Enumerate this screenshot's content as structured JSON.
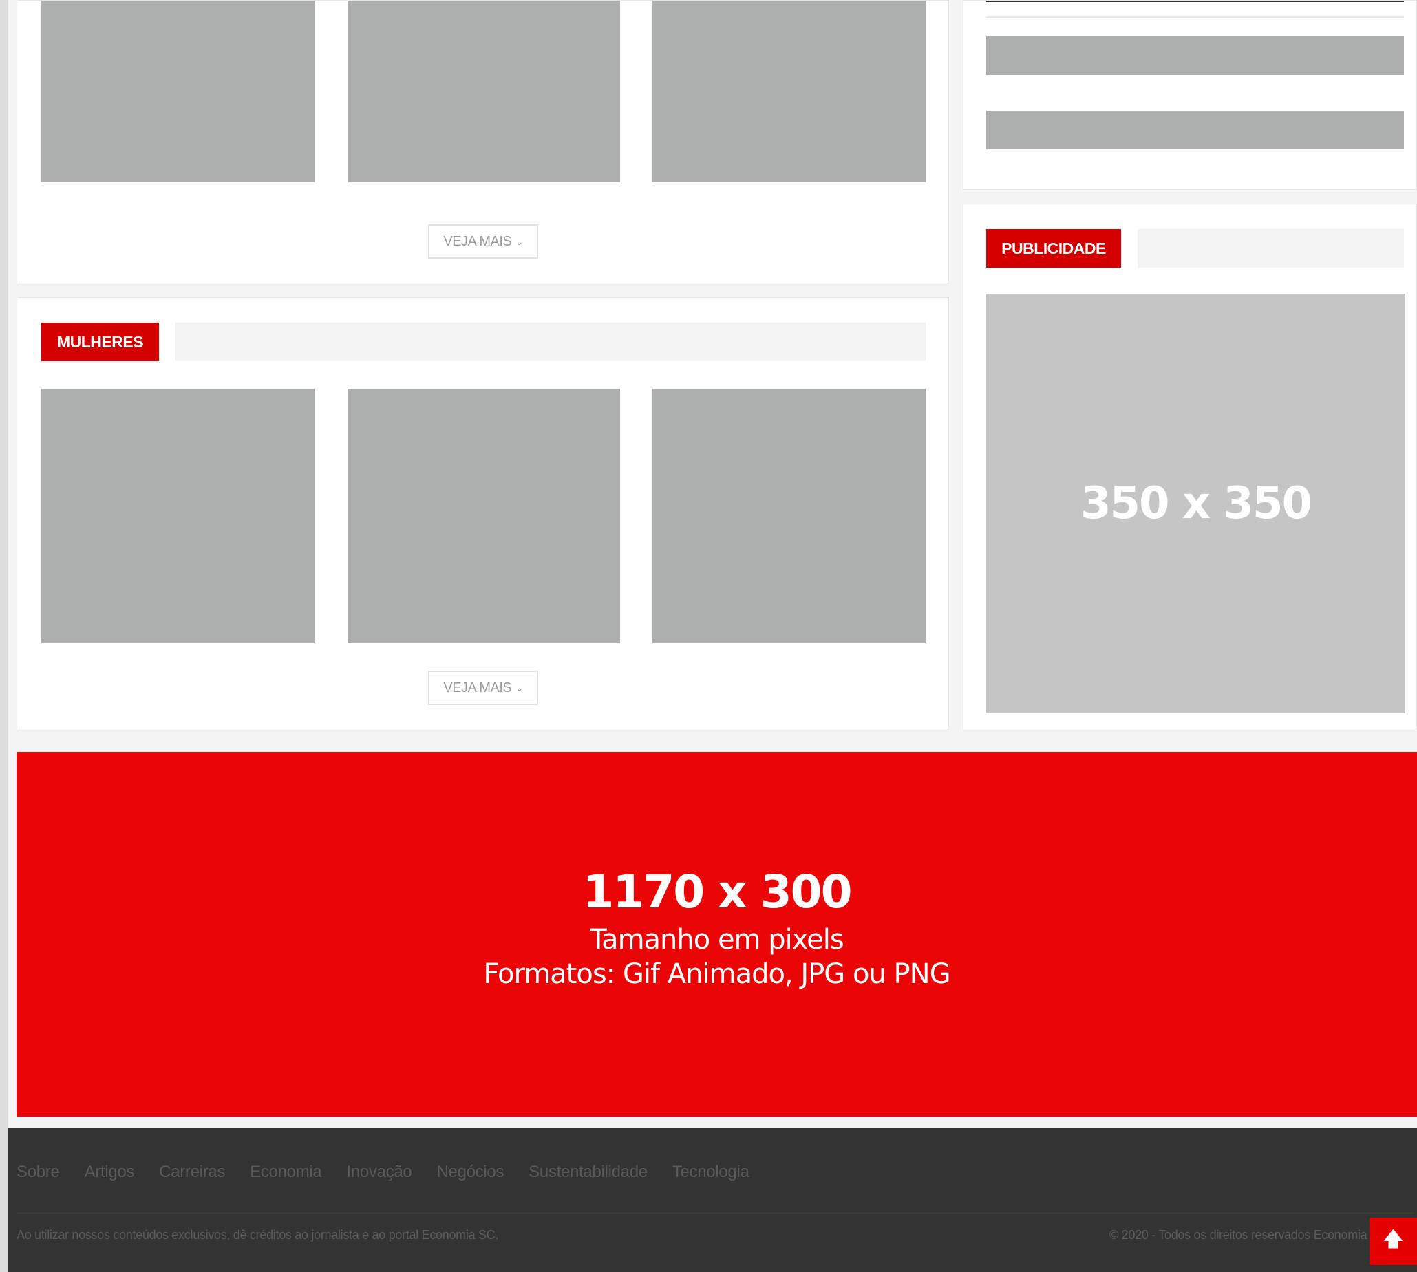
{
  "sections": {
    "top": {
      "more_label": "VEJA MAIS"
    },
    "mulheres": {
      "label": "MULHERES",
      "more_label": "VEJA MAIS"
    }
  },
  "sidebar": {
    "ad_label": "PUBLICIDADE",
    "ad_size": "350 x 350"
  },
  "banner": {
    "size": "1170 x 300",
    "line1": "Tamanho em pixels",
    "line2": "Formatos: Gif Animado, JPG ou PNG",
    "color": "#ea0606"
  },
  "footer": {
    "nav": [
      "Sobre",
      "Artigos",
      "Carreiras",
      "Economia",
      "Inovação",
      "Negócios",
      "Sustentabilidade",
      "Tecnologia"
    ],
    "note": "Ao utilizar nossos conteúdos exclusivos, dê créditos ao jornalista e ao portal Economia SC.",
    "copyright": "© 2020 - Todos os direitos reservados Economia SC",
    "background": "#333333"
  },
  "icons": {
    "chevron": "chevron-down-icon",
    "scroll_top": "arrow-up-icon"
  }
}
